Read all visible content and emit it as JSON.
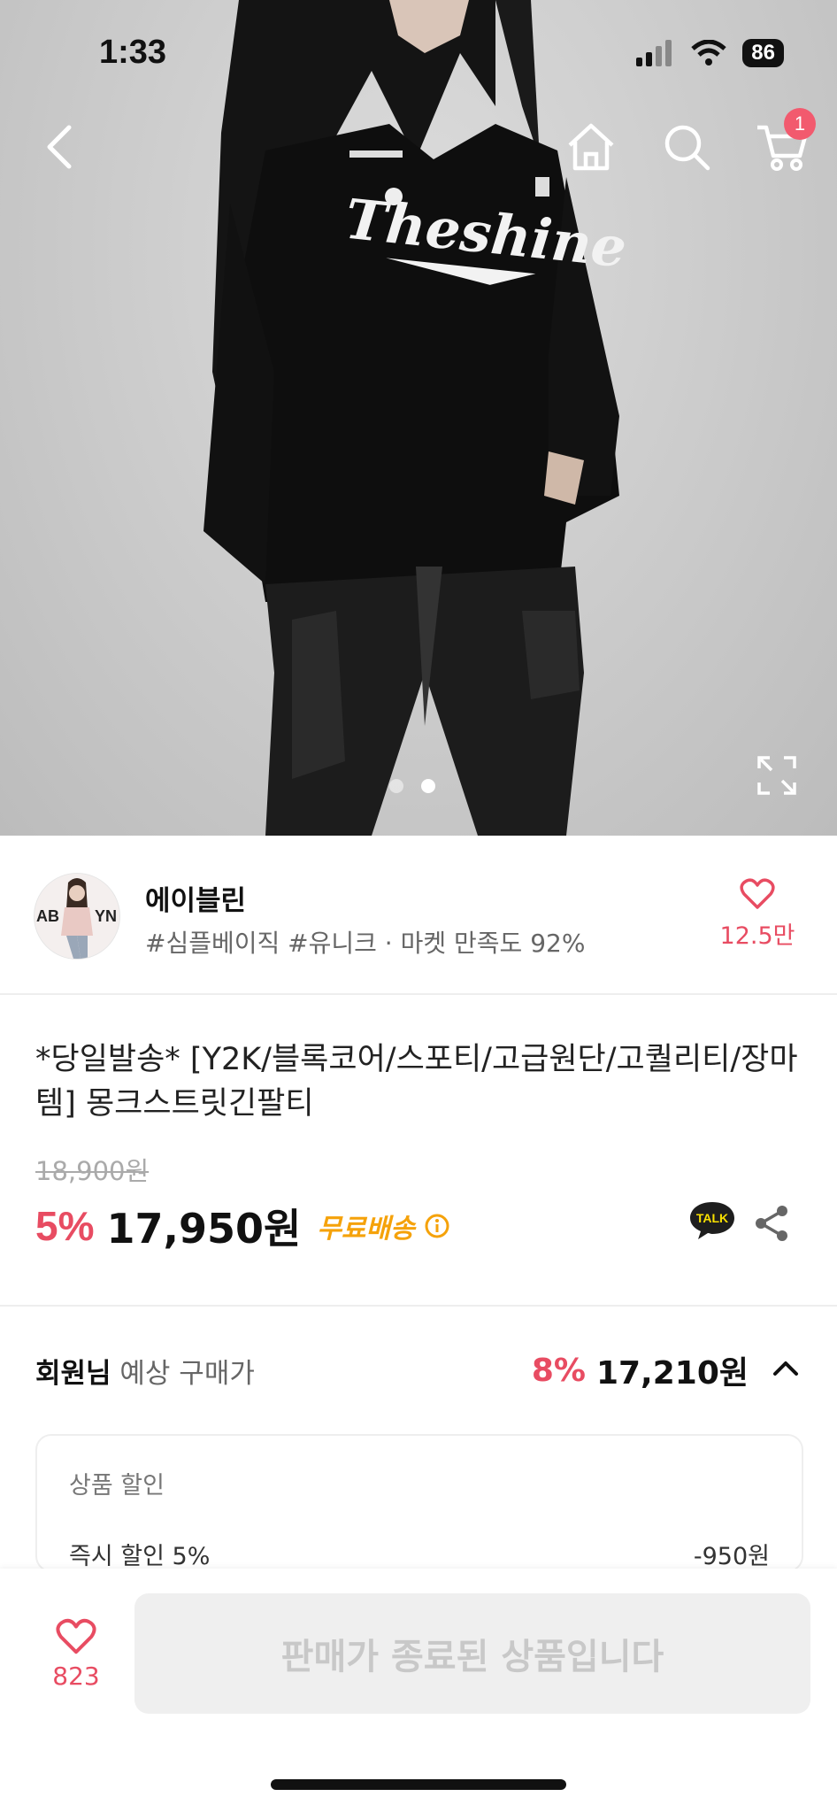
{
  "status": {
    "time": "1:33",
    "battery": "86"
  },
  "nav": {
    "cart_count": "1"
  },
  "hero": {
    "shirt_text": "Theshine",
    "page_count": 2,
    "active_page": 2
  },
  "seller": {
    "name": "에이블린",
    "tags": "#심플베이직 #유니크 · 마켓 만족도 92%",
    "likes": "12.5만",
    "avatar_text": "AB    YN"
  },
  "product": {
    "title": "*당일발송* [Y2K/블록코어/스포티/고급원단/고퀄리티/장마템] 몽크스트릿긴팔티",
    "original_price": "18,900원",
    "discount": "5%",
    "price": "17,950원",
    "shipping": "무료배송",
    "talk_label": "TALK"
  },
  "member": {
    "label_bold": "회원님",
    "label": " 예상 구매가",
    "discount": "8%",
    "price": "17,210원"
  },
  "discount_box": {
    "header": "상품 할인",
    "item_label": "즉시 할인 5%",
    "item_value": "-950원"
  },
  "bottom": {
    "wish_count": "823",
    "soldout_label": "판매가 종료된 상품입니다"
  },
  "colors": {
    "accent": "#e84c62",
    "shipping": "#f5a20a",
    "badge": "#f25a6e"
  }
}
